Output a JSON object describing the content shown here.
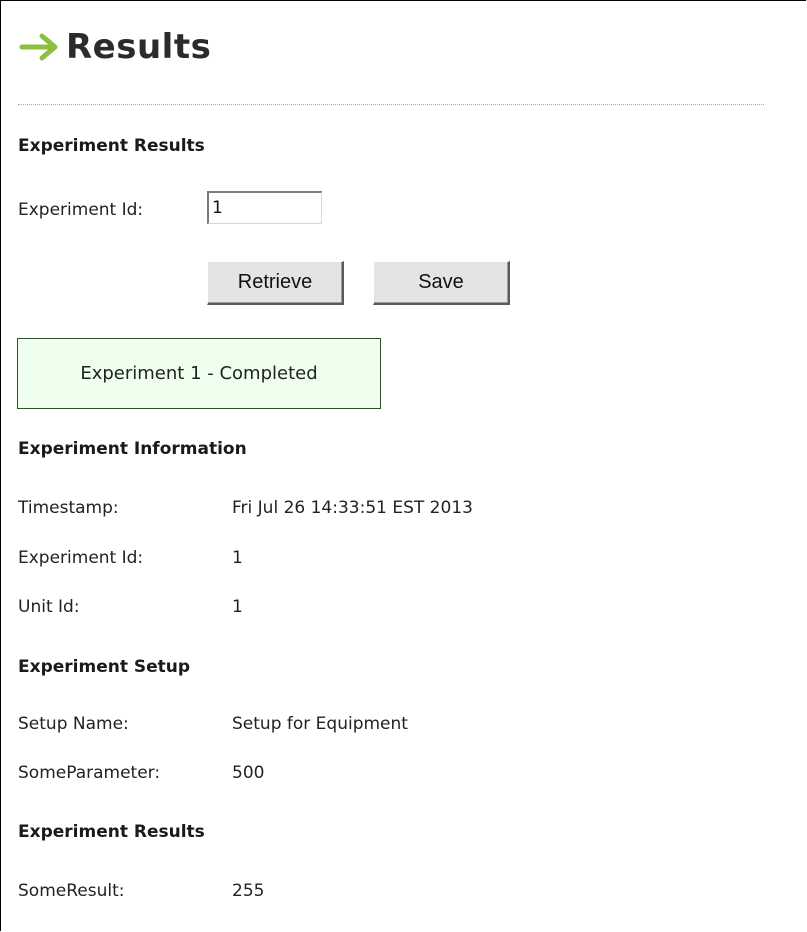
{
  "page": {
    "title": "Results",
    "arrow_color": "#8bbf3c"
  },
  "query": {
    "heading": "Experiment Results",
    "id_label": "Experiment Id:",
    "id_value": "1",
    "retrieve_label": "Retrieve",
    "save_label": "Save"
  },
  "status": {
    "message": "Experiment 1 - Completed",
    "background": "#eeffee"
  },
  "info": {
    "heading": "Experiment Information",
    "rows": [
      {
        "label": "Timestamp:",
        "value": "Fri Jul 26 14:33:51 EST 2013"
      },
      {
        "label": "Experiment Id:",
        "value": "1"
      },
      {
        "label": "Unit Id:",
        "value": "1"
      }
    ]
  },
  "setup": {
    "heading": "Experiment Setup",
    "rows": [
      {
        "label": "Setup Name:",
        "value": "Setup for Equipment"
      },
      {
        "label": "SomeParameter:",
        "value": "500"
      }
    ]
  },
  "results": {
    "heading": "Experiment Results",
    "rows": [
      {
        "label": "SomeResult:",
        "value": "255"
      }
    ]
  }
}
